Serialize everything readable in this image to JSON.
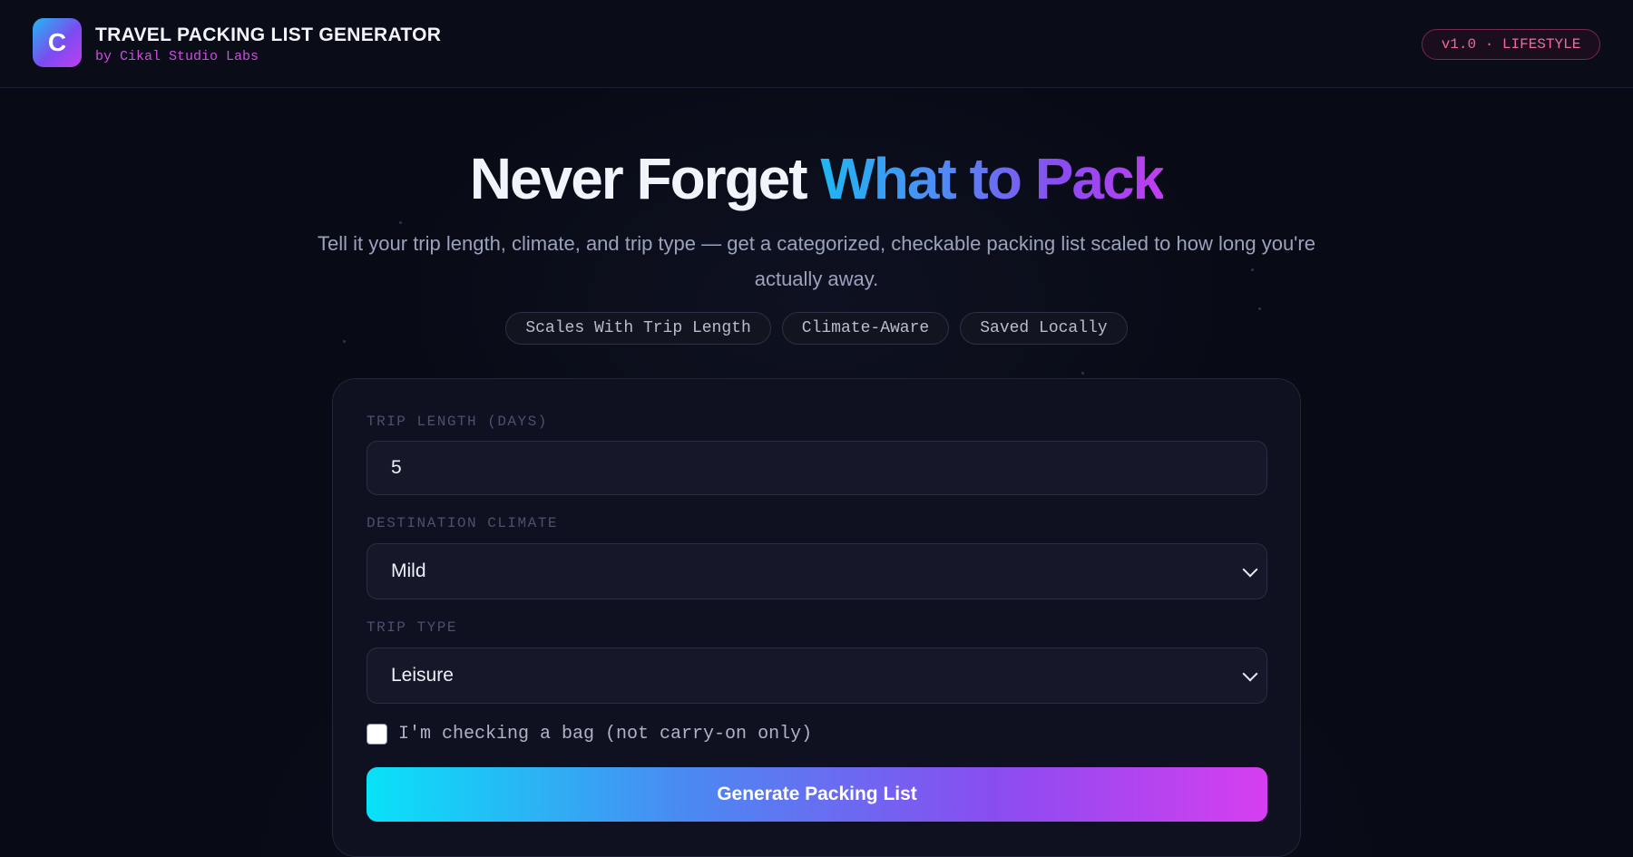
{
  "header": {
    "logo_letter": "C",
    "title": "TRAVEL PACKING LIST GENERATOR",
    "subtitle": "by Cikal Studio Labs",
    "badge": "v1.0 · LIFESTYLE"
  },
  "hero": {
    "title_plain": "Never Forget ",
    "title_gradient": "What to Pack",
    "subtitle": "Tell it your trip length, climate, and trip type — get a categorized, checkable packing list scaled to how long you're actually away.",
    "pills": [
      "Scales With Trip Length",
      "Climate-Aware",
      "Saved Locally"
    ]
  },
  "form": {
    "trip_length": {
      "label": "TRIP LENGTH (DAYS)",
      "value": "5"
    },
    "climate": {
      "label": "DESTINATION CLIMATE",
      "value": "Mild"
    },
    "trip_type": {
      "label": "TRIP TYPE",
      "value": "Leisure"
    },
    "checked_bag": {
      "label": "I'm checking a bag (not carry-on only)",
      "checked": false
    },
    "submit_label": "Generate Packing List"
  },
  "colors": {
    "accent_start": "#08e2f8",
    "accent_end": "#d63ef0",
    "badge_pink": "#f06aa0",
    "background": "#080a15"
  }
}
